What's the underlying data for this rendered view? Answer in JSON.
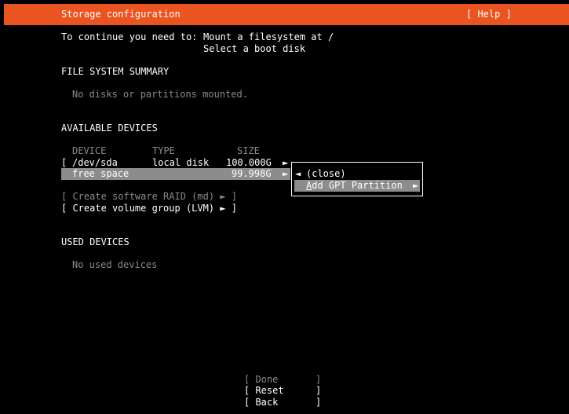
{
  "header": {
    "title": "Storage configuration",
    "help": "[ Help ]"
  },
  "intro": {
    "prefix": "To continue you need to:",
    "item1": "Mount a filesystem at /",
    "item2": "Select a boot disk"
  },
  "fs_summary": {
    "heading": "FILE SYSTEM SUMMARY",
    "empty": "No disks or partitions mounted."
  },
  "available": {
    "heading": "AVAILABLE DEVICES",
    "columns": [
      "DEVICE",
      "TYPE",
      "SIZE"
    ],
    "disk": {
      "bracket": "[",
      "device": "/dev/sda",
      "type": "local disk",
      "size": "100.000G",
      "arrow": "►"
    },
    "free": {
      "device": "free space",
      "size": "99.998G",
      "arrow": "►"
    },
    "raid": "[ Create software RAID (md) ► ]",
    "lvm": "[ Create volume group (LVM) ► ]"
  },
  "popup": {
    "close_arrow": "◄",
    "close": "(close)",
    "add_first": "A",
    "add_rest": "dd GPT Partition",
    "add_arrow": "►"
  },
  "used": {
    "heading": "USED DEVICES",
    "empty": "No used devices"
  },
  "buttons": {
    "done_l": "[ Done",
    "done_r": "]",
    "reset_l": "[ Reset",
    "reset_r": "]",
    "back_l": "[ Back",
    "back_r": "]"
  }
}
